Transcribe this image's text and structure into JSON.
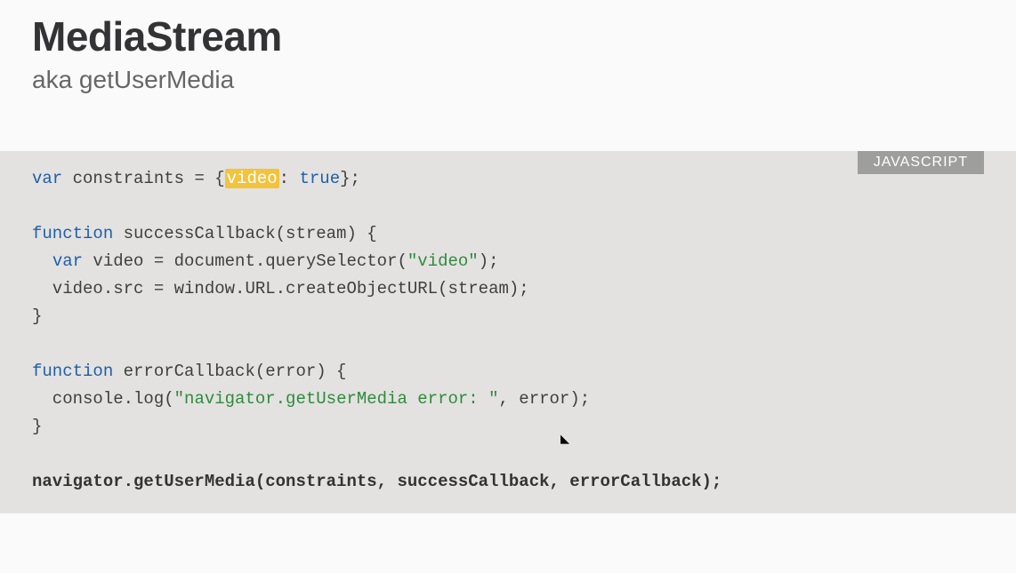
{
  "header": {
    "title": "MediaStream",
    "subtitle": "aka getUserMedia"
  },
  "code": {
    "language_label": "JAVASCRIPT",
    "tokens": {
      "kw_var1": "var",
      "constraints": " constraints = {",
      "video_hl": "video",
      "colon_sp": ": ",
      "true": "true",
      "close_obj": "};",
      "kw_fn1": "function",
      "fn1_sig": " successCallback(stream) {",
      "kw_var2": "var",
      "line3_rest": " video = document.querySelector(",
      "str_video": "\"video\"",
      "line3_end": ");",
      "line4": "  video.src = window.URL.createObjectURL(stream);",
      "close1": "}",
      "kw_fn2": "function",
      "fn2_sig": " errorCallback(error) {",
      "line7a": "  console.log(",
      "str_err": "\"navigator.getUserMedia error: \"",
      "line7b": ", error);",
      "close2": "}",
      "bold_line": "navigator.getUserMedia(constraints, successCallback, errorCallback);"
    }
  }
}
